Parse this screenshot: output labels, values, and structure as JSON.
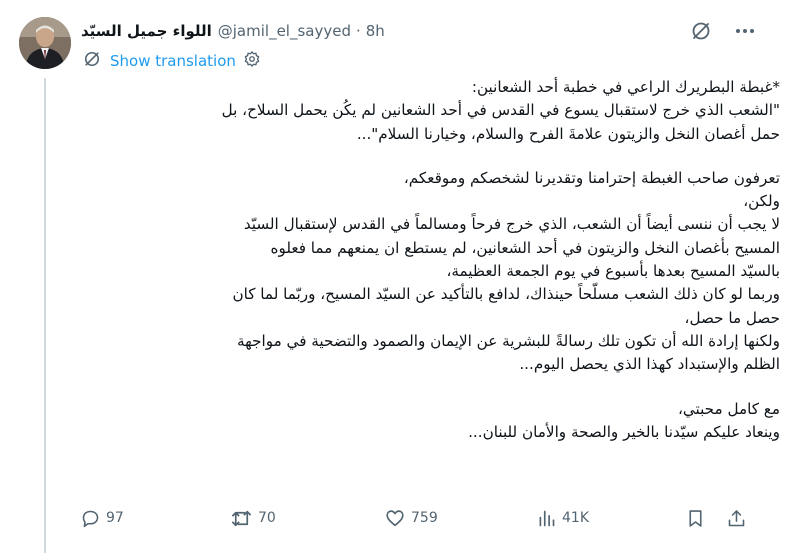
{
  "author": {
    "display_name": "اللواء جميل السيّد",
    "handle": "@jamil_el_sayyed",
    "separator": "·",
    "time": "8h"
  },
  "translate": {
    "label": "Show translation"
  },
  "body": {
    "p1_l1": "*غبطة البطريرك الراعي في خطبة أحد الشعانين:",
    "p1_l2": "\"الشعب الذي خرج لاستقبال يسوع في القدس في أحد الشعانين لم يكُن يحمل السلاح، بل",
    "p1_l3": "حمل أغصان النخل والزيتون علامةَ الفرح والسلام، وخيارنا السلام\"...",
    "p2_l1": "تعرفون صاحب الغبطة إحترامنا وتقديرنا لشخصكم وموقعكم،",
    "p2_l2": "ولكن،",
    "p2_l3": "لا يجب أن ننسى أيضاً أن الشعب، الذي خرج فرحاً ومسالماً في القدس لإستقبال السيّد",
    "p2_l4": "المسيح بأغصان النخل والزيتون في أحد الشعانين، لم يستطع ان يمنعهم مما فعلوه",
    "p2_l5": "بالسيّد المسيح بعدها بأسبوع في يوم الجمعة العظيمة،",
    "p2_l6": "وربما لو كان ذلك الشعب مسلّحاً حينذاك، لدافع بالتأكيد عن السيّد المسيح، وربّما لما كان",
    "p2_l7": "حصل ما حصل،",
    "p2_l8": "ولكنها إرادة الله أن تكون تلك رسالةً للبشرية عن الإيمان والصمود والتضحية في مواجهة",
    "p2_l9": "الظلم والإستبداد كهذا الذي يحصل اليوم...",
    "p3_l1": "مع كامل محبتي،",
    "p3_l2": "وينعاد عليكم سيّدنا بالخير والصحة والأمان للبنان..."
  },
  "actions": {
    "replies": "97",
    "reposts": "70",
    "likes": "759",
    "views": "41K"
  },
  "icons": [
    "grok-icon",
    "more-icon",
    "translate-icon",
    "gear-icon",
    "reply-icon",
    "repost-icon",
    "like-icon",
    "views-icon",
    "bookmark-icon",
    "share-icon"
  ],
  "colors": {
    "accent": "#1d9bf0",
    "muted": "#536471",
    "text": "#0f1419",
    "thread_line": "#cfd9de"
  }
}
